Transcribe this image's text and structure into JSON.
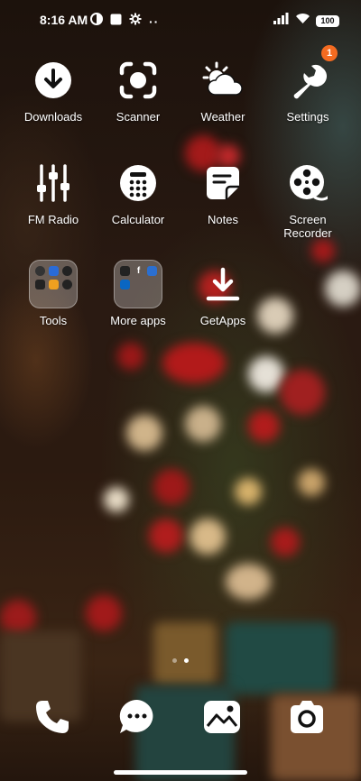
{
  "status_bar": {
    "time": "8:16 AM",
    "left_icons": [
      "data-saver-icon",
      "square-notification-icon",
      "gear-icon",
      "more-dots-icon"
    ],
    "right_icons": [
      "signal-icon",
      "wifi-icon"
    ],
    "battery": "100"
  },
  "apps": [
    {
      "label": "Downloads",
      "icon": "download-icon"
    },
    {
      "label": "Scanner",
      "icon": "scanner-icon"
    },
    {
      "label": "Weather",
      "icon": "weather-icon"
    },
    {
      "label": "Settings",
      "icon": "wrench-icon",
      "badge": "1"
    },
    {
      "label": "FM Radio",
      "icon": "equalizer-icon"
    },
    {
      "label": "Calculator",
      "icon": "calculator-icon"
    },
    {
      "label": "Notes",
      "icon": "notes-icon"
    },
    {
      "label": "Screen\nRecorder",
      "icon": "film-reel-icon"
    },
    {
      "label": "Tools",
      "icon": "folder-icon"
    },
    {
      "label": "More apps",
      "icon": "folder-icon"
    },
    {
      "label": "GetApps",
      "icon": "get-apps-icon"
    }
  ],
  "dock": [
    "phone-icon",
    "messages-icon",
    "gallery-icon",
    "camera-icon"
  ],
  "colors": {
    "badge": "#f36b21",
    "icon": "#ffffff"
  }
}
